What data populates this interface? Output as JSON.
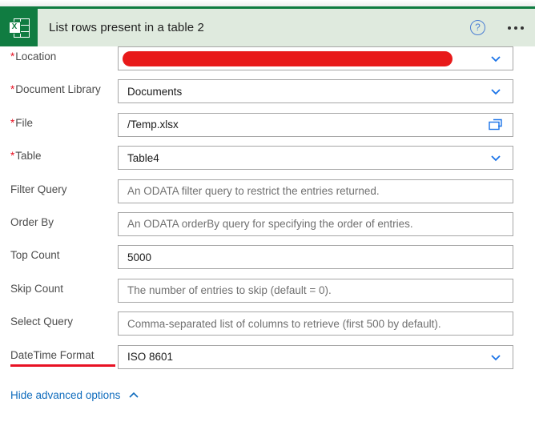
{
  "header": {
    "title": "List rows present in a table 2",
    "app_icon": "excel-icon",
    "icon_letter": "X",
    "help_icon": "help-circle-icon",
    "help_glyph": "?",
    "more_icon": "ellipsis-icon",
    "bg_color": "#dfeade",
    "icon_bg_color": "#107c41"
  },
  "fields": [
    {
      "label": "Location",
      "required": true,
      "value": "",
      "placeholder": "",
      "control": "dropdown",
      "redacted": true,
      "redaction_color": "#e81a1a"
    },
    {
      "label": "Document Library",
      "required": true,
      "value": "Documents",
      "placeholder": "",
      "control": "dropdown",
      "redacted": false
    },
    {
      "label": "File",
      "required": true,
      "value": "/Temp.xlsx",
      "placeholder": "",
      "control": "file-picker",
      "redacted": false
    },
    {
      "label": "Table",
      "required": true,
      "value": "Table4",
      "placeholder": "",
      "control": "dropdown",
      "redacted": false
    },
    {
      "label": "Filter Query",
      "required": false,
      "value": "",
      "placeholder": "An ODATA filter query to restrict the entries returned.",
      "control": "text",
      "redacted": false
    },
    {
      "label": "Order By",
      "required": false,
      "value": "",
      "placeholder": "An ODATA orderBy query for specifying the order of entries.",
      "control": "text",
      "redacted": false
    },
    {
      "label": "Top Count",
      "required": false,
      "value": "5000",
      "placeholder": "",
      "control": "text",
      "redacted": false
    },
    {
      "label": "Skip Count",
      "required": false,
      "value": "",
      "placeholder": "The number of entries to skip (default = 0).",
      "control": "text",
      "redacted": false
    },
    {
      "label": "Select Query",
      "required": false,
      "value": "",
      "placeholder": "Comma-separated list of columns to retrieve (first 500 by default).",
      "control": "text",
      "redacted": false
    },
    {
      "label": "DateTime Format",
      "required": false,
      "value": "ISO 8601",
      "placeholder": "",
      "control": "dropdown",
      "redacted": false,
      "annotated": true,
      "annotation_color": "#e81123"
    }
  ],
  "footer": {
    "link_label": "Hide advanced options",
    "chevron_icon": "chevron-up-icon",
    "link_color": "#0f6cbd"
  }
}
